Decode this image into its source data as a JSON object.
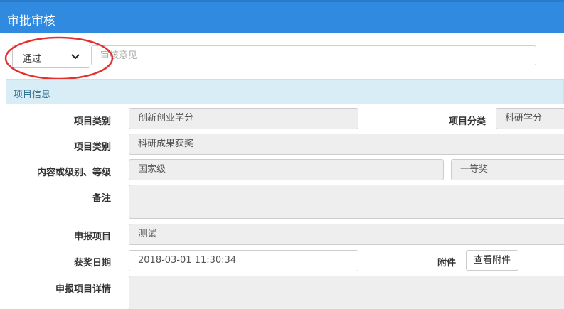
{
  "dialog": {
    "title": "审批审核"
  },
  "review": {
    "decision": "通过",
    "opinion_placeholder": "审核意见"
  },
  "section": {
    "title": "项目信息"
  },
  "fields": {
    "project_category_label": "项目类别",
    "project_category_value": "创新创业学分",
    "project_class_label": "项目分类",
    "project_class_value": "科研学分",
    "project_category2_label": "项目类别",
    "project_category2_value": "科研成果获奖",
    "level_label": "内容或级别、等级",
    "level_value": "国家级",
    "grade_value": "一等奖",
    "remark_label": "备注",
    "remark_value": "",
    "apply_project_label": "申报项目",
    "apply_project_value": "测试",
    "award_date_label": "获奖日期",
    "award_date_value": "2018-03-01 11:30:34",
    "attachment_label": "附件",
    "attachment_button": "查看附件",
    "apply_detail_label": "申报项目详情",
    "apply_detail_value": ""
  },
  "colors": {
    "header_bg": "#2f8ae0",
    "section_bg": "#d9edf7",
    "annotation": "#e53030"
  },
  "icons": {
    "dropdown": "chevron-down-icon"
  }
}
